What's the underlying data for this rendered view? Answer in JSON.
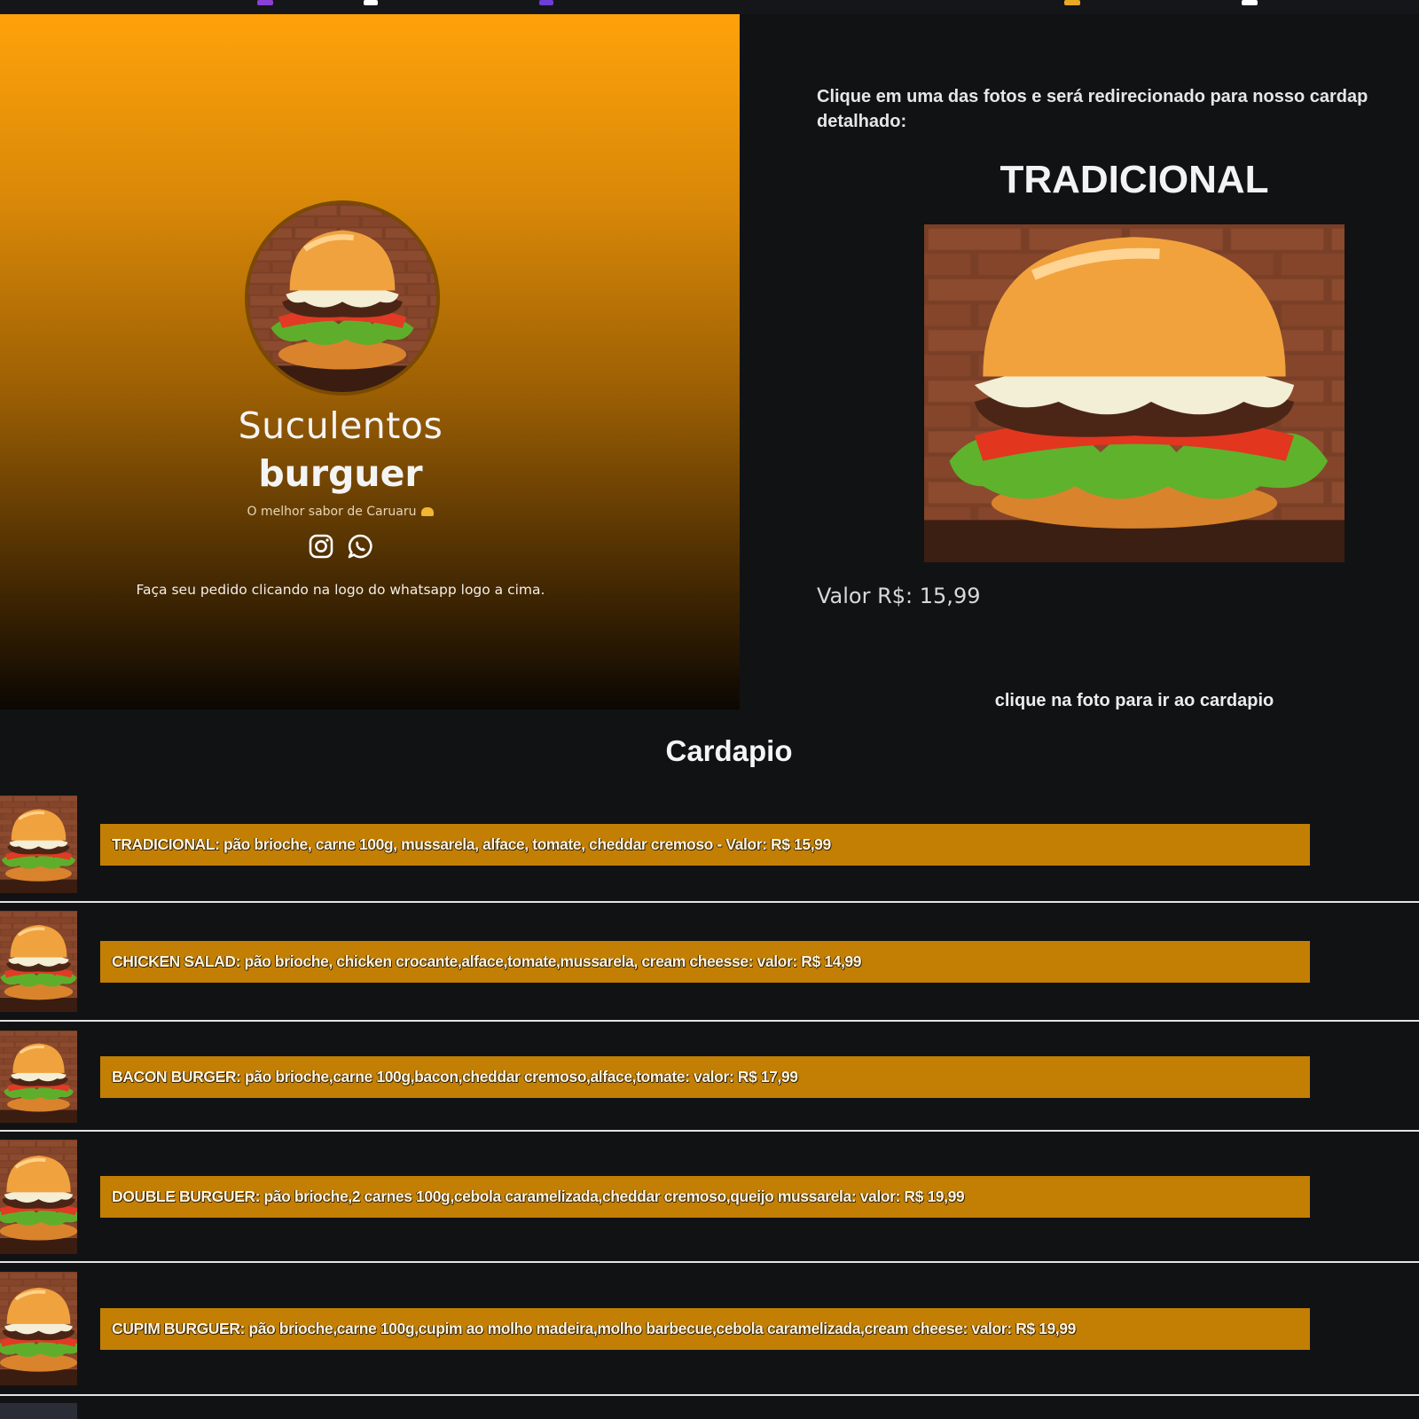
{
  "colors": {
    "page_background": "#111214",
    "hero_gradient_top": "#ffa20a",
    "hero_gradient_bottom": "#0b0702",
    "menu_bar": "#c27f03"
  },
  "hero": {
    "brand_line1": "Suculentos",
    "brand_line2": "burguer",
    "tagline": "O melhor sabor de Caruaru",
    "social_icons": [
      "instagram-icon",
      "whatsapp-icon"
    ],
    "order_hint": "Faça seu pedido clicando na logo do whatsapp logo a cima."
  },
  "feature": {
    "intro_line1": "Clique em uma das fotos e será redirecionado para nosso cardap",
    "intro_line2": "detalhado:",
    "title": "TRADICIONAL",
    "price": "Valor R$: 15,99",
    "photo_hint": "clique na foto para ir ao cardapio"
  },
  "menu": {
    "title": "Cardapio",
    "items": [
      {
        "text": "TRADICIONAL: pão brioche, carne 100g, mussarela, alface, tomate, cheddar cremoso - Valor: R$ 15,99"
      },
      {
        "text": "CHICKEN SALAD: pão brioche, chicken crocante,alface,tomate,mussarela, cream cheesse: valor: R$ 14,99"
      },
      {
        "text": "BACON BURGER: pão brioche,carne 100g,bacon,cheddar cremoso,alface,tomate: valor: R$ 17,99"
      },
      {
        "text": "DOUBLE BURGUER: pão brioche,2 carnes 100g,cebola caramelizada,cheddar cremoso,queijo mussarela: valor: R$ 19,99"
      },
      {
        "text": "CUPIM BURGUER: pão brioche,carne 100g,cupim ao molho madeira,molho barbecue,cebola caramelizada,cream cheese: valor: R$ 19,99"
      }
    ]
  }
}
